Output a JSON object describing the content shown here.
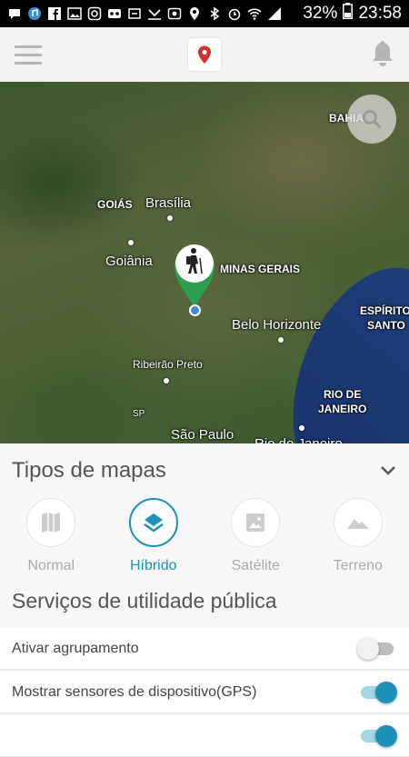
{
  "status_bar": {
    "battery": "32%",
    "time": "23:58"
  },
  "map": {
    "labels": {
      "bahia": "BAHIA",
      "goias": "GOIÁS",
      "brasilia": "Brasília",
      "goiania": "Goiânia",
      "minas_gerais": "MINAS GERAIS",
      "belo_horizonte": "Belo Horizonte",
      "espirito_santo_1": "ESPÍRITO",
      "espirito_santo_2": "SANTO",
      "ribeirao_preto": "Ribeirão Preto",
      "sp": "SP",
      "rio_1": "RIO DE",
      "rio_2": "JANEIRO",
      "sao_paulo": "São Paulo",
      "rio_city": "Rio de Janeiro"
    }
  },
  "panel": {
    "map_types_title": "Tipos de mapas",
    "map_types": [
      {
        "label": "Normal",
        "icon": "map-icon",
        "active": false
      },
      {
        "label": "Híbrido",
        "icon": "layers-icon",
        "active": true
      },
      {
        "label": "Satélite",
        "icon": "image-icon",
        "active": false
      },
      {
        "label": "Terreno",
        "icon": "terrain-icon",
        "active": false
      }
    ],
    "services_title": "Serviços de utilidade pública",
    "settings": [
      {
        "label": "Ativar agrupamento",
        "on": false
      },
      {
        "label": "Mostrar sensores de dispositivo(GPS)",
        "on": true
      }
    ]
  },
  "colors": {
    "accent": "#1e8fb6",
    "pin_green": "#2e9e4f",
    "logo_pin": "#d0302f"
  }
}
